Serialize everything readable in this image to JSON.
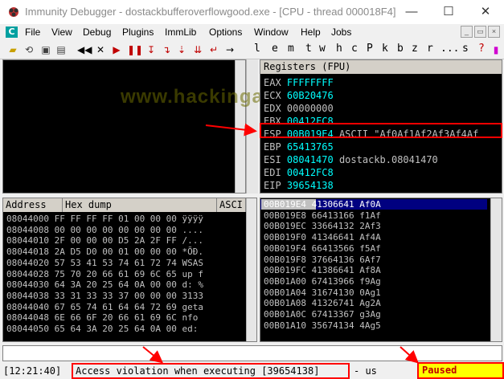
{
  "window": {
    "title": "Immunity Debugger - dostackbufferoverflowgood.exe - [CPU - thread 000018F4]",
    "minimize": "—",
    "maximize": "☐",
    "close": "✕"
  },
  "menu": {
    "cpu_icon": "C",
    "items": [
      "File",
      "View",
      "Debug",
      "Plugins",
      "ImmLib",
      "Options",
      "Window",
      "Help",
      "Jobs"
    ],
    "mdi": [
      "_",
      "▭",
      "×"
    ]
  },
  "toolbar": {
    "letters": [
      "l",
      "e",
      "m",
      "t",
      "w",
      "h",
      "c",
      "P",
      "k",
      "b",
      "z",
      "r",
      "...",
      "s",
      "?"
    ]
  },
  "watermark": "www.hackingarticles.in",
  "registers": {
    "header": "Registers (FPU)",
    "rows": [
      {
        "name": "EAX",
        "value": "FFFFFFFF",
        "comment": ""
      },
      {
        "name": "ECX",
        "value": "60B20476",
        "comment": ""
      },
      {
        "name": "EDX",
        "value": "00000000",
        "comment": ""
      },
      {
        "name": "EBX",
        "value": "00412FC8",
        "comment": ""
      },
      {
        "name": "ESP",
        "value": "00B019E4",
        "comment": "ASCII \"Af0Af1Af2Af3Af4Af"
      },
      {
        "name": "EBP",
        "value": "65413765",
        "comment": ""
      },
      {
        "name": "ESI",
        "value": "08041470",
        "comment": "dostackb.08041470"
      },
      {
        "name": "EDI",
        "value": "00412FC8",
        "comment": ""
      },
      {
        "name": "EIP",
        "value": "39654138",
        "comment": ""
      }
    ]
  },
  "hexdump": {
    "col_address": "Address",
    "col_hex": "Hex dump",
    "col_ascii": "ASCI",
    "rows": [
      "08044000 FF FF FF FF 01 00 00 00 ÿÿÿÿ",
      "08044008 00 00 00 00 00 00 00 00 ....",
      "08044010 2F 00 00 00 D5 2A 2F FF /...",
      "08044018 2A D5 D0 00 01 00 00 00 *ÕÐ.",
      "08044020 57 53 41 53 74 61 72 74 WSAS",
      "08044028 75 70 20 66 61 69 6C 65 up f",
      "08044030 64 3A 20 25 64 0A 00 00 d: %",
      "08044038 33 31 33 33 37 00 00 00 3133",
      "08044040 67 65 74 61 64 64 72 69 geta",
      "08044048 6E 66 6F 20 66 61 69 6C nfo ",
      "08044050 65 64 3A 20 25 64 0A 00 ed: "
    ]
  },
  "stack": {
    "rows": [
      "00B019E4 41306641 Af0A",
      "00B019E8 66413166 f1Af",
      "00B019EC 33664132 2Af3",
      "00B019F0 41346641 Af4A",
      "00B019F4 66413566 f5Af",
      "00B019F8 37664136 6Af7",
      "00B019FC 41386641 Af8A",
      "00B01A00 67413966 f9Ag",
      "00B01A04 31674130 0Ag1",
      "00B01A08 41326741 Ag2A",
      "00B01A0C 67413367 g3Ag",
      "00B01A10 35674134 4Ag5"
    ]
  },
  "status": {
    "time": "[12:21:40]",
    "message": "Access violation when executing [39654138]",
    "suffix": "- us",
    "state": "Paused"
  },
  "colors": {
    "register_value": "#00ffff",
    "highlight": "#ff0000",
    "paused_bg": "#ffff00",
    "paused_fg": "#c00000",
    "selection": "#000080"
  }
}
